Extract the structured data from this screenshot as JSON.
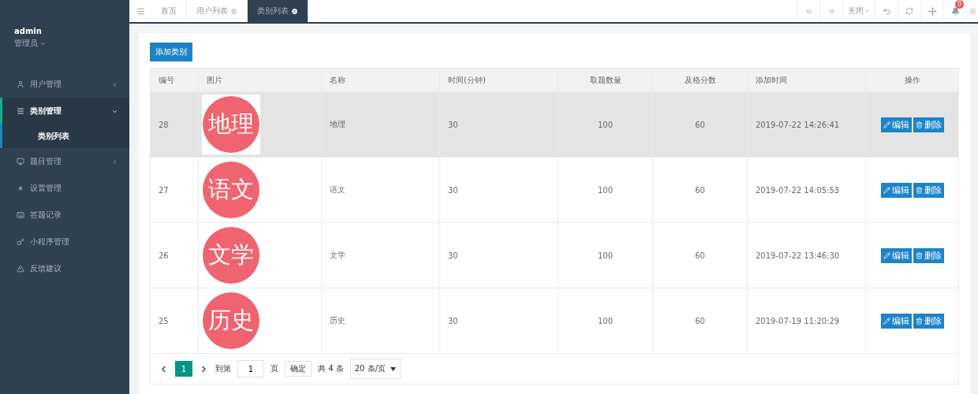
{
  "user": {
    "name": "admin",
    "role": "管理员"
  },
  "sidebar": {
    "items": [
      {
        "label": "用户管理",
        "expanded": false,
        "selected": false
      },
      {
        "label": "类别管理",
        "expanded": true,
        "selected": true,
        "children": [
          {
            "label": "类别列表",
            "selected": true
          }
        ]
      },
      {
        "label": "题目管理",
        "expanded": false,
        "selected": false
      },
      {
        "label": "设置管理",
        "selected": false
      },
      {
        "label": "答题记录",
        "selected": false
      },
      {
        "label": "小程序管理",
        "selected": false
      },
      {
        "label": "反馈建议",
        "selected": false
      }
    ]
  },
  "tabs": [
    {
      "label": "首页",
      "closable": false,
      "selected": false
    },
    {
      "label": "用户列表",
      "closable": true,
      "selected": false
    },
    {
      "label": "类别列表",
      "closable": true,
      "selected": true
    }
  ],
  "toolbar": {
    "close_label": "关闭",
    "notifications": "0"
  },
  "add_button": "添加类别",
  "table": {
    "columns": [
      "编号",
      "图片",
      "名称",
      "时间(分钟)",
      "取题数量",
      "及格分数",
      "添加时间",
      "操作"
    ],
    "rows": [
      {
        "id": "28",
        "image_text": "地理",
        "name": "地理",
        "minutes": "30",
        "count": "100",
        "pass": "60",
        "added": "2019-07-22 14:26:41",
        "highlighted": true,
        "actions": [
          "编辑",
          "删除"
        ]
      },
      {
        "id": "27",
        "image_text": "语文",
        "name": "语文",
        "minutes": "30",
        "count": "100",
        "pass": "60",
        "added": "2019-07-22 14:05:53",
        "highlighted": false,
        "actions": [
          "编辑",
          "删除"
        ]
      },
      {
        "id": "26",
        "image_text": "文学",
        "name": "文学",
        "minutes": "30",
        "count": "100",
        "pass": "60",
        "added": "2019-07-22 13:46:30",
        "highlighted": false,
        "actions": [
          "编辑",
          "删除"
        ]
      },
      {
        "id": "25",
        "image_text": "历史",
        "name": "历史",
        "minutes": "30",
        "count": "100",
        "pass": "60",
        "added": "2019-07-19 11:20:29",
        "highlighted": false,
        "actions": [
          "编辑",
          "删除"
        ]
      }
    ]
  },
  "pagination": {
    "pages": [
      {
        "label": "1",
        "selected": true
      }
    ],
    "goto_label": "到第",
    "goto_value": "1",
    "page_label": "页",
    "confirm": "确定",
    "total": "共 4 条",
    "page_size": "20 条/页"
  }
}
